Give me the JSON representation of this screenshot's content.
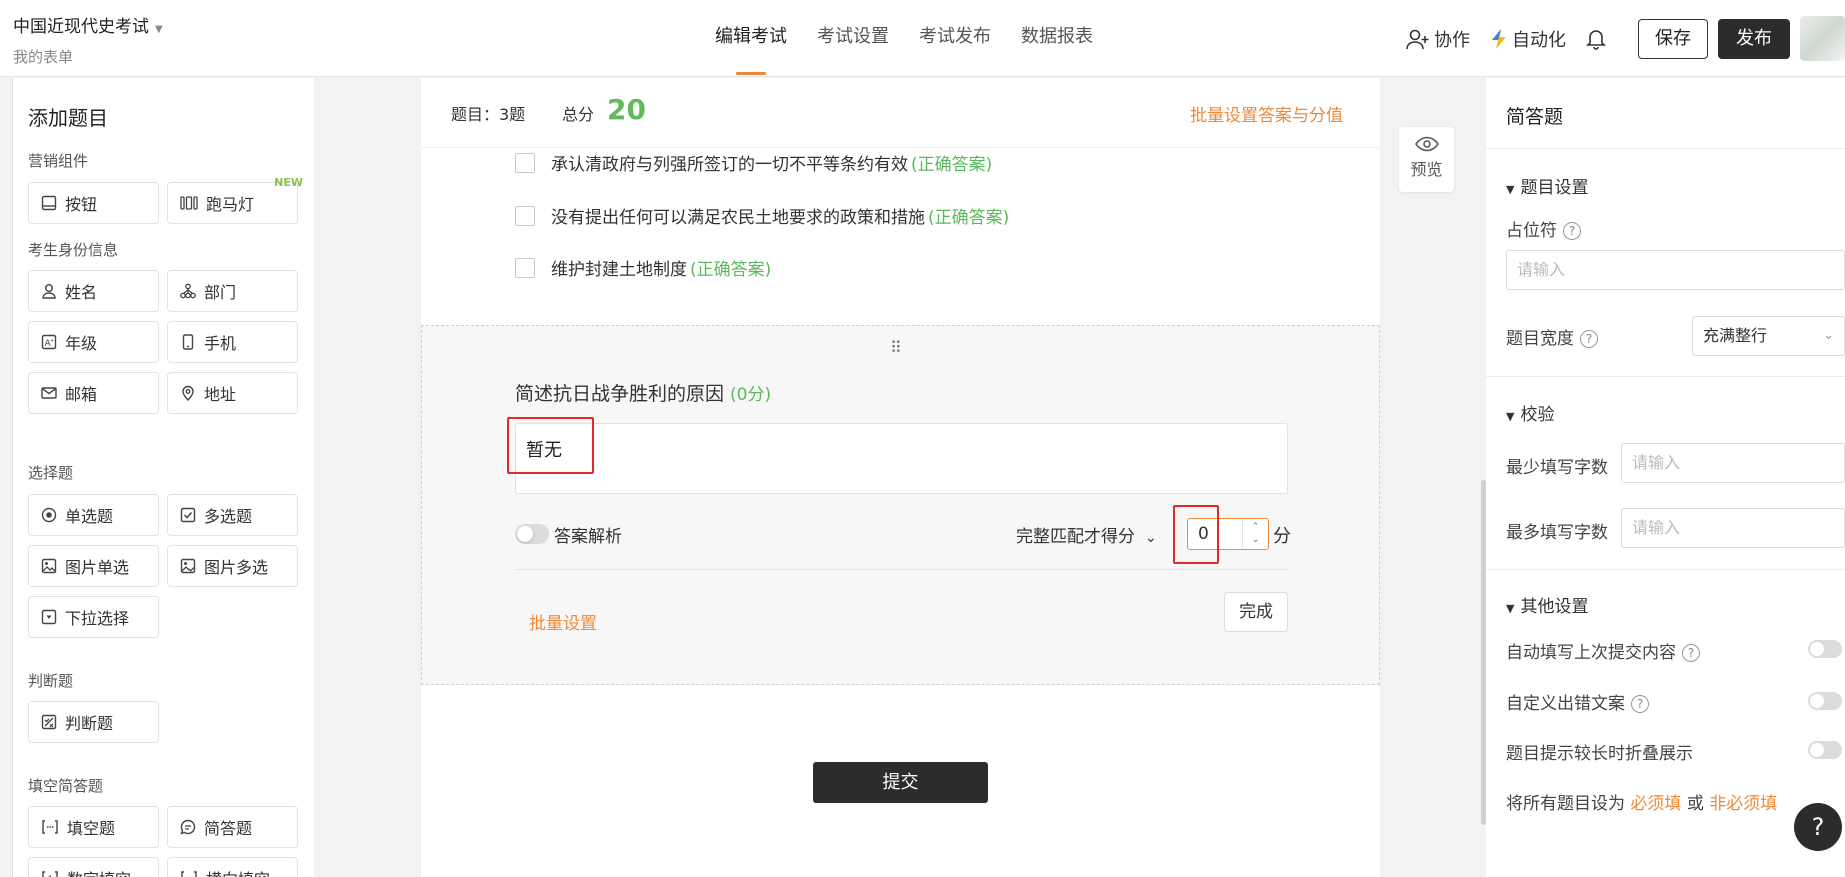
{
  "header": {
    "app_title": "中国近现代史考试",
    "app_subtitle": "我的表单",
    "tabs": [
      {
        "label": "编辑考试",
        "active": true
      },
      {
        "label": "考试设置"
      },
      {
        "label": "考试发布"
      },
      {
        "label": "数据报表"
      }
    ],
    "collab_label": "协作",
    "automation_label": "自动化",
    "save_label": "保存",
    "publish_label": "发布"
  },
  "left_panel": {
    "title": "添加题目",
    "groups": [
      {
        "label": "营销组件",
        "items": [
          {
            "label": "按钮",
            "icon": "button-icon"
          },
          {
            "label": "跑马灯",
            "icon": "marquee-icon",
            "badge": "NEW"
          }
        ]
      },
      {
        "label": "考生身份信息",
        "items": [
          {
            "label": "姓名",
            "icon": "user-icon"
          },
          {
            "label": "部门",
            "icon": "org-icon"
          },
          {
            "label": "年级",
            "icon": "grade-icon"
          },
          {
            "label": "手机",
            "icon": "phone-icon"
          },
          {
            "label": "邮箱",
            "icon": "mail-icon"
          },
          {
            "label": "地址",
            "icon": "location-icon"
          }
        ]
      },
      {
        "label": "选择题",
        "items": [
          {
            "label": "单选题",
            "icon": "radio-icon"
          },
          {
            "label": "多选题",
            "icon": "checkbox-icon"
          },
          {
            "label": "图片单选",
            "icon": "image-icon"
          },
          {
            "label": "图片多选",
            "icon": "image-multi-icon"
          },
          {
            "label": "下拉选择",
            "icon": "dropdown-icon"
          }
        ]
      },
      {
        "label": "判断题",
        "items": [
          {
            "label": "判断题",
            "icon": "judge-icon"
          }
        ]
      },
      {
        "label": "填空简答题",
        "items": [
          {
            "label": "填空题",
            "icon": "fill-blank-icon"
          },
          {
            "label": "简答题",
            "icon": "comment-icon"
          },
          {
            "label": "数字填空",
            "icon": "number-icon"
          },
          {
            "label": "横向填空",
            "icon": "horizontal-fill-icon"
          }
        ]
      }
    ]
  },
  "canvas": {
    "question_count_label": "题目：3题",
    "total_label": "总分",
    "total_value": "20",
    "batch_answer_link": "批量设置答案与分值",
    "options": [
      {
        "text": "承认清政府与列强所签订的一切不平等条约有效",
        "tag": "(正确答案)"
      },
      {
        "text": "没有提出任何可以满足农民土地要求的政策和措施",
        "tag": "(正确答案)"
      },
      {
        "text": "维护封建土地制度",
        "tag": "(正确答案)"
      }
    ],
    "question": {
      "title": "简述抗日战争胜利的原因",
      "points": "(0分)",
      "answer": "暂无",
      "analysis_label": "答案解析",
      "match_label": "完整匹配才得分",
      "score_value": "0",
      "score_unit": "分",
      "batch_label": "批量设置",
      "done_label": "完成"
    },
    "submit_label": "提交",
    "preview_label": "预览"
  },
  "right_panel": {
    "title": "简答题",
    "sections": {
      "question_settings": "题目设置",
      "validation": "校验",
      "other": "其他设置"
    },
    "placeholder_label": "占位符",
    "placeholder_input": "请输入",
    "width_label": "题目宽度",
    "width_value": "充满整行",
    "min_label": "最少填写字数",
    "min_placeholder": "请输入",
    "max_label": "最多填写字数",
    "max_placeholder": "请输入",
    "toggles": [
      {
        "label": "自动填写上次提交内容",
        "help": true
      },
      {
        "label": "自定义出错文案",
        "help": true
      },
      {
        "label": "题目提示较长时折叠展示",
        "help": false
      }
    ],
    "footer_prefix": "将所有题目设为",
    "footer_required": "必须填",
    "footer_or": "或",
    "footer_optional": "非必须填"
  },
  "colors": {
    "accent": "#ef8a3a",
    "correct": "#5cb85c",
    "highlight": "#e12b2b",
    "dark": "#2c2c2c"
  }
}
